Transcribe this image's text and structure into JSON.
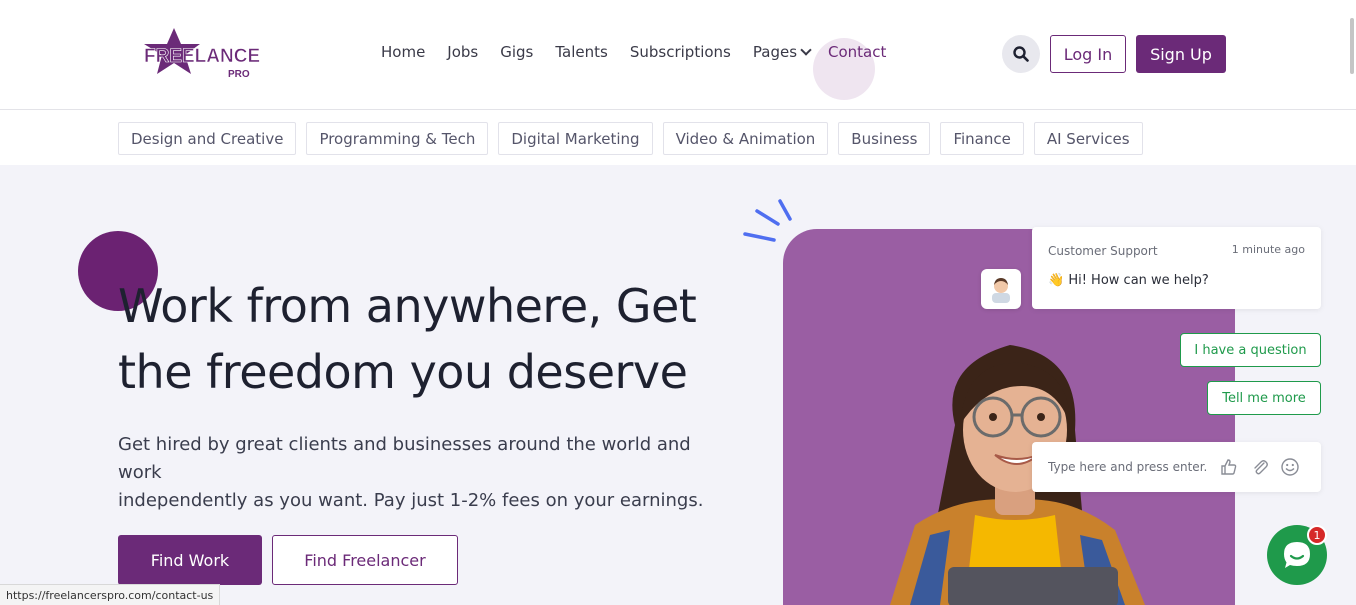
{
  "logo": {
    "word": "FREELANCER",
    "sub": "PRO"
  },
  "nav": {
    "items": [
      {
        "label": "Home"
      },
      {
        "label": "Jobs"
      },
      {
        "label": "Gigs"
      },
      {
        "label": "Talents"
      },
      {
        "label": "Subscriptions"
      },
      {
        "label": "Pages"
      },
      {
        "label": "Contact"
      }
    ],
    "active": "Contact"
  },
  "header": {
    "login_label": "Log In",
    "signup_label": "Sign Up"
  },
  "categories": [
    "Design and Creative",
    "Programming & Tech",
    "Digital Marketing",
    "Video & Animation",
    "Business",
    "Finance",
    "AI Services"
  ],
  "hero": {
    "title_line1": "Work from anywhere, Get",
    "title_line2": "the freedom you deserve",
    "subtitle_line1": "Get hired by great clients and businesses around the world and work",
    "subtitle_line2": "independently as you want. Pay just 1-2% fees on your earnings.",
    "find_work_label": "Find Work",
    "find_freelancer_label": "Find Freelancer"
  },
  "chat": {
    "agent_name": "Customer Support",
    "time": "1 minute ago",
    "message": "👋 Hi! How can we help?",
    "quick_replies": [
      "I have a question",
      "Tell me more"
    ],
    "input_placeholder": "Type here and press enter..",
    "unread_count": "1"
  },
  "status_url": "https://freelancerspro.com/contact-us",
  "colors": {
    "brand": "#6b2a78",
    "panel": "#9a5ea3",
    "chat_green": "#1f9a4b"
  }
}
